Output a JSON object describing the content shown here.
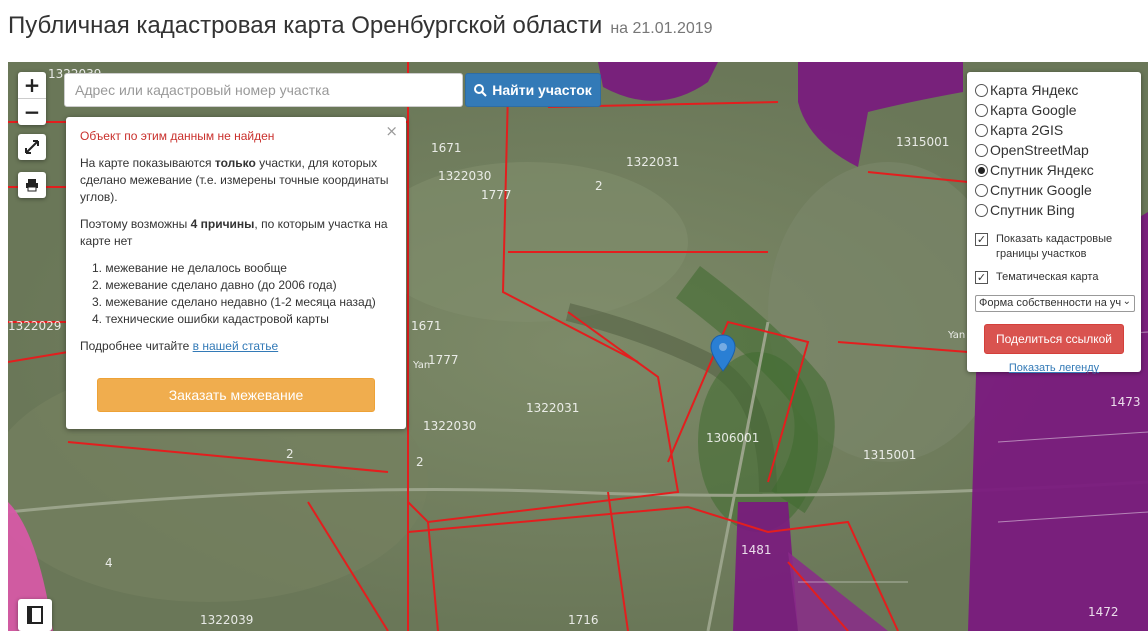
{
  "header": {
    "title": "Публичная кадастровая карта Оренбургской области",
    "date": "на 21.01.2019"
  },
  "map": {
    "zoom_in": "+",
    "zoom_out": "−",
    "labels": [
      "1322039",
      "1671",
      "1322030",
      "1777",
      "1322031",
      "2",
      "1315001",
      "1322029",
      "1777",
      "1671",
      "1322030",
      "1322031",
      "1306001",
      "1315001",
      "2",
      "2",
      "4",
      "1481",
      "1473",
      "1472",
      "1322039",
      "1716"
    ],
    "yandex_marks": [
      "Yan",
      "Yan"
    ]
  },
  "search": {
    "placeholder": "Адрес или кадастровый номер участка",
    "button": "Найти участок"
  },
  "popup": {
    "close": "×",
    "error": "Объект по этим данным не найден",
    "p1_pre": "На карте показываются ",
    "p1_bold": "только",
    "p1_post": " участки, для которых сделано межевание (т.е. измерены точные координаты углов).",
    "p2_pre": "Поэтому возможны ",
    "p2_bold": "4 причины",
    "p2_post": ", по которым участка на карте нет",
    "reasons": [
      "1. межевание не делалось вообще",
      "2. межевание сделано давно (до 2006 года)",
      "3. межевание сделано недавно (1-2 месяца назад)",
      "4. технические ошибки кадастровой карты"
    ],
    "more_pre": "Подробнее читайте ",
    "more_link": "в нашей статье",
    "order_button": "Заказать межевание"
  },
  "layers": {
    "options": [
      {
        "label": "Карта Яндекс",
        "checked": false
      },
      {
        "label": "Карта Google",
        "checked": false
      },
      {
        "label": "Карта 2GIS",
        "checked": false
      },
      {
        "label": "OpenStreetMap",
        "checked": false
      },
      {
        "label": "Спутник Яндекс",
        "checked": true
      },
      {
        "label": "Спутник Google",
        "checked": false
      },
      {
        "label": "Спутник Bing",
        "checked": false
      }
    ],
    "show_borders": "Показать кадастровые границы участков",
    "thematic": "Тематическая карта",
    "select_value": "Форма собственности на уч",
    "share_button": "Поделиться ссылкой",
    "legend_link": "Показать легенду"
  },
  "colors": {
    "parcel_border": "#e31e1e",
    "purple": "#7a1a7e",
    "pink": "#d65aa5",
    "primary": "#337ab7",
    "warning": "#f0ad4e",
    "danger": "#d9534f"
  }
}
